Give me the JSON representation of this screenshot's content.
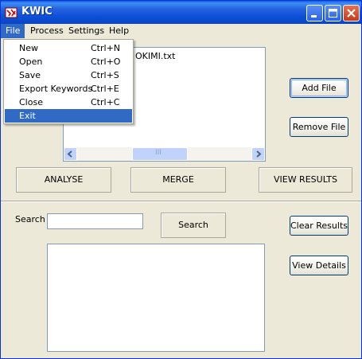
{
  "window": {
    "title": "KWIC"
  },
  "menubar": {
    "file": "File",
    "process": "Process",
    "settings": "Settings",
    "help": "Help"
  },
  "file_menu": [
    {
      "label": "New",
      "shortcut": "Ctrl+N"
    },
    {
      "label": "Open",
      "shortcut": "Ctrl+O"
    },
    {
      "label": "Save",
      "shortcut": "Ctrl+S"
    },
    {
      "label": "Export Keywords",
      "shortcut": "Ctrl+E"
    },
    {
      "label": "Close",
      "shortcut": "Ctrl+C"
    },
    {
      "label": "Exit",
      "shortcut": ""
    }
  ],
  "file_list": {
    "visible_item": "OKIMI.txt",
    "scroll_glyph": "III"
  },
  "buttons": {
    "add_file": "Add File",
    "remove_file": "Remove File",
    "analyse": "ANALYSE",
    "merge": "MERGE",
    "view_results": "VIEW RESULTS",
    "search": "Search",
    "clear_results": "Clear Results",
    "view_details": "View Details"
  },
  "search": {
    "label": "Search",
    "value": ""
  },
  "colors": {
    "title_bar": "#0b4fd6",
    "menu_highlight": "#316ac5",
    "window_bg": "#ece9d8"
  }
}
